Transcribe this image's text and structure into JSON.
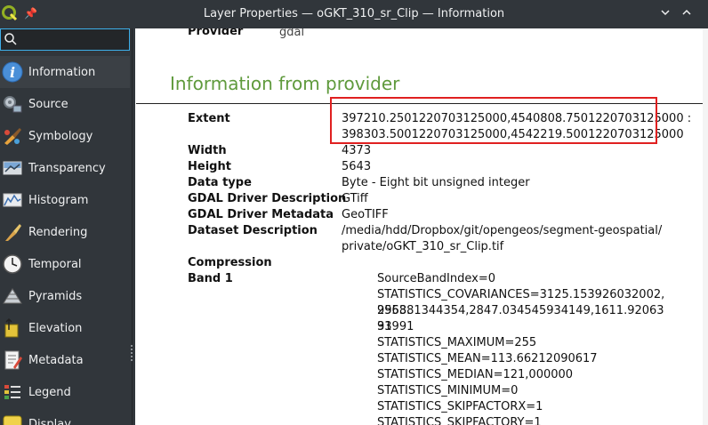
{
  "window": {
    "title": "Layer Properties — oGKT_310_sr_Clip — Information"
  },
  "sidebar": {
    "search": {
      "value": "",
      "placeholder": ""
    },
    "items": [
      {
        "label": "Information",
        "icon": "info-icon"
      },
      {
        "label": "Source",
        "icon": "source-icon"
      },
      {
        "label": "Symbology",
        "icon": "symbology-icon"
      },
      {
        "label": "Transparency",
        "icon": "transparency-icon"
      },
      {
        "label": "Histogram",
        "icon": "histogram-icon"
      },
      {
        "label": "Rendering",
        "icon": "rendering-icon"
      },
      {
        "label": "Temporal",
        "icon": "clock-icon"
      },
      {
        "label": "Pyramids",
        "icon": "pyramid-icon"
      },
      {
        "label": "Elevation",
        "icon": "elevation-icon"
      },
      {
        "label": "Metadata",
        "icon": "metadata-icon"
      },
      {
        "label": "Legend",
        "icon": "legend-icon"
      },
      {
        "label": "Display",
        "icon": "display-icon"
      }
    ]
  },
  "content": {
    "cut_row": {
      "label": "Provider",
      "value": "gdal"
    },
    "section_title": "Information from provider",
    "rows": [
      {
        "label": "Extent",
        "value": "397210.2501220703125000,4540808.7501220703125000 :\n398303.5001220703125000,4542219.5001220703125000"
      },
      {
        "label": "Width",
        "value": "4373"
      },
      {
        "label": "Height",
        "value": "5643"
      },
      {
        "label": "Data type",
        "value": "Byte - Eight bit unsigned integer"
      },
      {
        "label": "GDAL Driver Description",
        "value": "GTiff"
      },
      {
        "label": "GDAL Driver Metadata",
        "value": "GeoTIFF"
      },
      {
        "label": "Dataset Description",
        "value": "/media/hdd/Dropbox/git/opengeos/segment-geospatial/\nprivate/oGKT_310_sr_Clip.tif"
      },
      {
        "label": "Compression",
        "value": ""
      },
      {
        "label": "Band 1",
        "value": ""
      }
    ],
    "band1_lines": [
      "SourceBandIndex=0",
      "STATISTICS_COVARIANCES=3125.153926032002,2953.",
      "956881344354,2847.034545934149,1611.9206331991",
      "93",
      "STATISTICS_MAXIMUM=255",
      "STATISTICS_MEAN=113.66212090617",
      "STATISTICS_MEDIAN=121,000000",
      "STATISTICS_MINIMUM=0",
      "STATISTICS_SKIPFACTORX=1",
      "STATISTICS_SKIPFACTORY=1"
    ]
  },
  "colors": {
    "accent": "#3daee9",
    "heading": "#5f9a3c",
    "highlight": "#e02020",
    "chrome": "#31363b"
  }
}
